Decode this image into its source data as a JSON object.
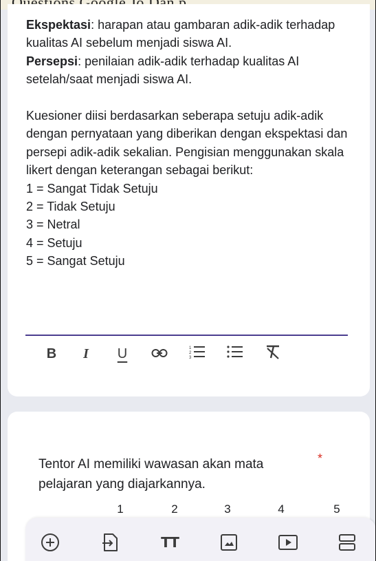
{
  "top_strip": {
    "text": "Questions  Google Jo  Dan  p"
  },
  "description": {
    "ekspektasi_term": "Ekspektasi",
    "ekspektasi_text": ": harapan atau gambaran adik-adik terhadap kualitas AI sebelum menjadi siswa AI.",
    "persepsi_term": "Persepsi",
    "persepsi_text": ": penilaian adik-adik terhadap kualitas AI setelah/saat menjadi siswa AI.",
    "paragraph": "Kuesioner diisi berdasarkan seberapa setuju adik-adik dengan pernyataan yang diberikan dengan ekspektasi dan persepi adik-adik sekalian. Pengisian menggunakan skala likert dengan keterangan sebagai berikut:",
    "scale_items": [
      "1 = Sangat Tidak Setuju",
      "2 = Tidak Setuju",
      "3 = Netral",
      "4 = Setuju",
      "5 = Sangat Setuju"
    ]
  },
  "format_toolbar": {
    "bold": "B",
    "italic": "I",
    "underline": "U"
  },
  "question": {
    "text": "Tentor AI memiliki wawasan akan mata pelajaran yang diajarkannya.",
    "required_mark": "*",
    "scale_labels": [
      "1",
      "2",
      "3",
      "4",
      "5"
    ]
  },
  "bottom_toolbar": {
    "icons": [
      "add-question-icon",
      "import-questions-icon",
      "add-title-icon",
      "add-image-icon",
      "add-video-icon",
      "add-section-icon"
    ],
    "title_glyph": "TT"
  },
  "colors": {
    "underline_accent": "#4a3d8f",
    "required": "#d93025",
    "background": "#e8eaf0"
  }
}
